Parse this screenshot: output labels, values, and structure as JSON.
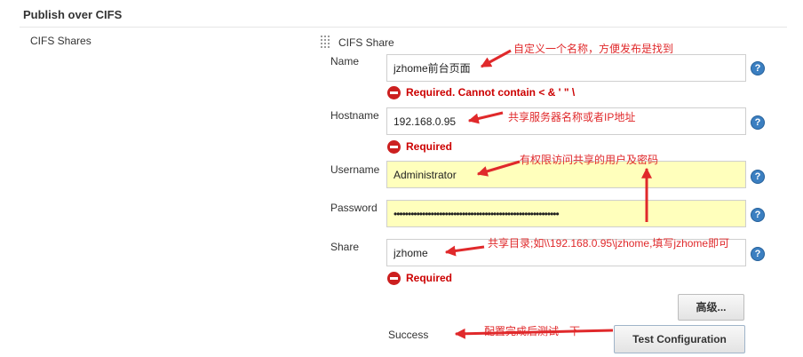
{
  "section": {
    "title": "Publish over CIFS",
    "left_label": "CIFS Shares"
  },
  "block": {
    "title": "CIFS Share"
  },
  "fields": {
    "name": {
      "label": "Name",
      "value": "jzhome前台页面",
      "error": "Required. Cannot contain < & ' \" \\"
    },
    "hostname": {
      "label": "Hostname",
      "value": "192.168.0.95",
      "error": "Required"
    },
    "username": {
      "label": "Username",
      "value": "Administrator"
    },
    "password": {
      "label": "Password",
      "value": "••••••••••••••••••••••••••••••••••••••••••••••••••••••••••"
    },
    "share": {
      "label": "Share",
      "value": "jzhome",
      "error": "Required"
    }
  },
  "help_glyph": "?",
  "buttons": {
    "advanced": "高级...",
    "test": "Test Configuration"
  },
  "status": {
    "success": "Success"
  },
  "annotations": {
    "name_note": "自定义一个名称，方便发布是找到",
    "hostname_note": "共享服务器名称或者IP地址",
    "credentials_note": "有权限访问共享的用户及密码",
    "share_note": "共享目录;如\\\\192.168.0.95\\jzhome,填写jzhome即可",
    "test_note": "配置完成后测试一下"
  },
  "colors": {
    "annotation": "#e0292b",
    "error": "#cc0000",
    "help": "#3b7fc1",
    "highlight_field": "#ffffbc"
  }
}
